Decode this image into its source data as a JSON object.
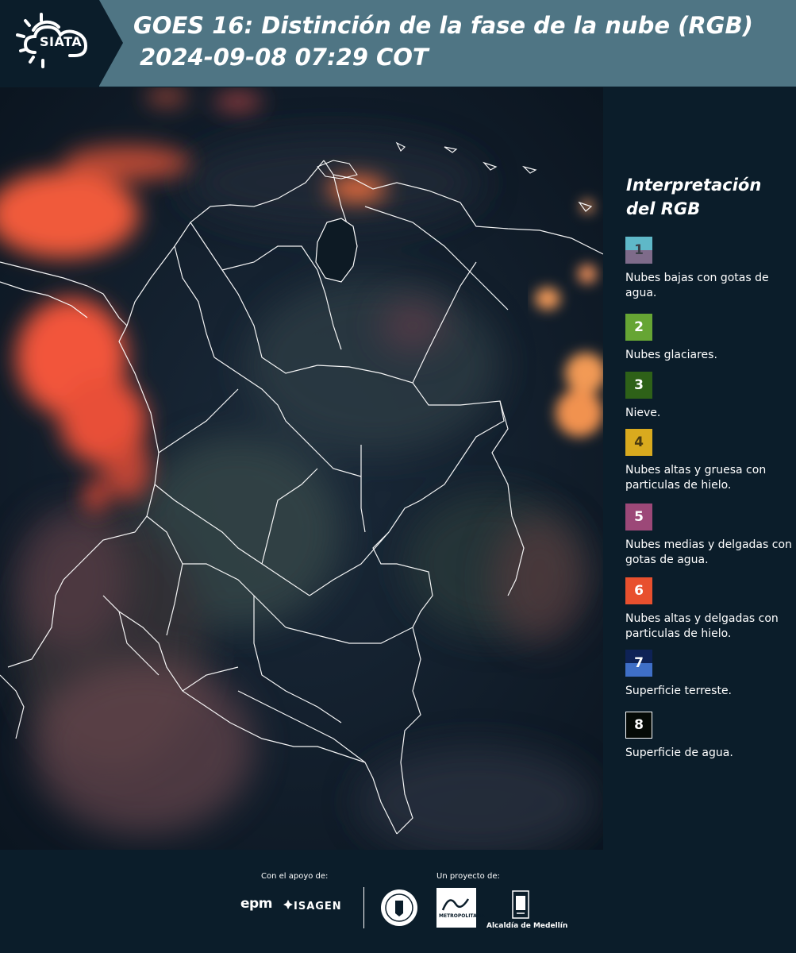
{
  "header": {
    "logo_text": "SIATA",
    "title": "GOES 16: Distinción de la fase de la nube (RGB)",
    "subtitle": "2024-09-08 07:29 COT"
  },
  "legend": {
    "title": "Interpretación del RGB",
    "items": [
      {
        "num": "1",
        "label": "Nubes bajas con gotas de agua.",
        "color_top": "#5fb8c8",
        "color_bottom": "#7e6b8a"
      },
      {
        "num": "2",
        "label": "Nubes glaciares.",
        "color": "#66a534"
      },
      {
        "num": "3",
        "label": "Nieve.",
        "color": "#2e6118"
      },
      {
        "num": "4",
        "label": "Nubes altas y gruesa con particulas de hielo.",
        "color": "#d9aa1e"
      },
      {
        "num": "5",
        "label": "Nubes medias y delgadas con gotas de agua.",
        "color": "#9c4878"
      },
      {
        "num": "6",
        "label": "Nubes altas y delgadas con particulas de hielo.",
        "color": "#e8502e"
      },
      {
        "num": "7",
        "label": "Superficie terreste.",
        "color_top": "#0e2256",
        "color_bottom": "#3f6fc7"
      },
      {
        "num": "8",
        "label": "Superficie de agua.",
        "color": "#050a06"
      }
    ]
  },
  "footer": {
    "support_label": "Con el apoyo de:",
    "project_label": "Un proyecto de:",
    "epm": "epm",
    "isagen": "ISAGEN",
    "area_text": "METROPOLITANA",
    "alcaldia": "Alcaldía de Medellín"
  }
}
